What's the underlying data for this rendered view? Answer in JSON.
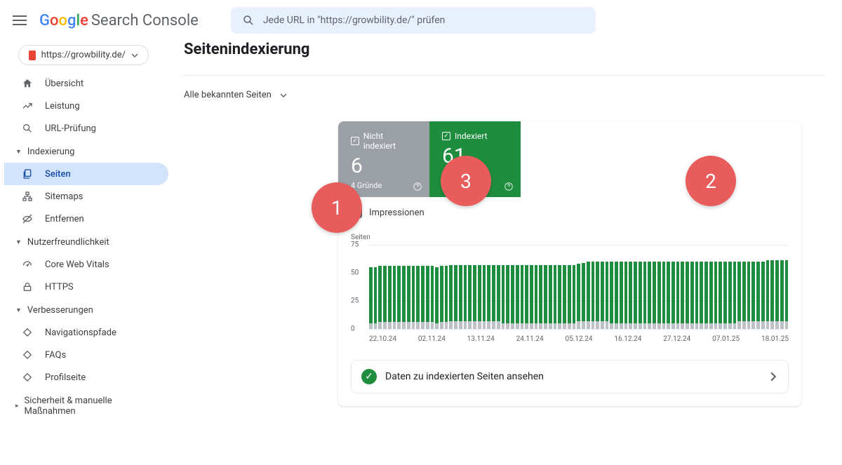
{
  "header": {
    "product_name": "Search Console",
    "search_placeholder": "Jede URL in \"https://growbility.de/\" prüfen"
  },
  "property": {
    "url": "https://growbility.de/"
  },
  "sidebar": {
    "items_top": [
      {
        "label": "Übersicht",
        "icon": "home"
      },
      {
        "label": "Leistung",
        "icon": "trend"
      },
      {
        "label": "URL-Prüfung",
        "icon": "search"
      }
    ],
    "section_index": "Indexierung",
    "items_index": [
      {
        "label": "Seiten",
        "icon": "pages",
        "active": true
      },
      {
        "label": "Sitemaps",
        "icon": "sitemaps"
      },
      {
        "label": "Entfernen",
        "icon": "remove"
      }
    ],
    "section_ux": "Nutzerfreundlichkeit",
    "items_ux": [
      {
        "label": "Core Web Vitals",
        "icon": "speed"
      },
      {
        "label": "HTTPS",
        "icon": "lock"
      }
    ],
    "section_enh": "Verbesserungen",
    "items_enh": [
      {
        "label": "Navigationspfade",
        "icon": "diamond"
      },
      {
        "label": "FAQs",
        "icon": "diamond"
      },
      {
        "label": "Profilseite",
        "icon": "diamond"
      }
    ],
    "section_sec": "Sicherheit & manuelle Maßnahmen"
  },
  "main": {
    "title": "Seitenindexierung",
    "filter": "Alle bekannten Seiten",
    "tile_not_indexed": {
      "label": "Nicht indexiert",
      "value": "6",
      "sub": "4 Gründe"
    },
    "tile_indexed": {
      "label": "Indexiert",
      "value": "61"
    },
    "impressions_label": "Impressionen",
    "cta_label": "Daten zu indexierten Seiten ansehen"
  },
  "annotations": {
    "a1": "1",
    "a2": "2",
    "a3": "3"
  },
  "chart_data": {
    "type": "bar",
    "title": "Seiten",
    "ylabel": "Seiten",
    "ylim": [
      0,
      75
    ],
    "yticks": [
      0,
      25,
      50,
      75
    ],
    "x_start": "22.10.24",
    "x_end": "18.01.25",
    "xticks": [
      "22.10.24",
      "02.11.24",
      "13.11.24",
      "24.11.24",
      "05.12.24",
      "16.12.24",
      "27.12.24",
      "07.01.25",
      "18.01.25"
    ],
    "series": [
      {
        "name": "Indexiert",
        "color": "#1e8e3e",
        "values": [
          55,
          55,
          56,
          56,
          56,
          56,
          56,
          56,
          56,
          56,
          56,
          56,
          56,
          56,
          55,
          56,
          56,
          57,
          57,
          57,
          57,
          57,
          57,
          57,
          57,
          57,
          57,
          57,
          57,
          57,
          57,
          57,
          57,
          57,
          57,
          57,
          57,
          57,
          57,
          57,
          57,
          57,
          57,
          57,
          58,
          59,
          60,
          60,
          60,
          60,
          60,
          60,
          60,
          60,
          60,
          60,
          60,
          60,
          60,
          60,
          60,
          60,
          60,
          60,
          60,
          60,
          60,
          60,
          60,
          60,
          60,
          60,
          60,
          60,
          60,
          60,
          60,
          60,
          60,
          60,
          60,
          60,
          60,
          60,
          61,
          61,
          61,
          61,
          61
        ]
      },
      {
        "name": "Nicht indexiert",
        "color": "#bdc1c6",
        "values": [
          5,
          5,
          6,
          6,
          6,
          6,
          6,
          6,
          6,
          6,
          6,
          6,
          6,
          6,
          5,
          6,
          6,
          7,
          7,
          7,
          7,
          7,
          7,
          7,
          7,
          7,
          7,
          7,
          5,
          5,
          5,
          5,
          5,
          5,
          5,
          5,
          5,
          5,
          5,
          5,
          5,
          5,
          5,
          5,
          7,
          7,
          7,
          7,
          7,
          7,
          7,
          5,
          5,
          5,
          5,
          5,
          5,
          5,
          5,
          5,
          5,
          5,
          5,
          5,
          5,
          5,
          5,
          5,
          5,
          5,
          5,
          5,
          5,
          5,
          5,
          5,
          5,
          5,
          7,
          7,
          7,
          7,
          7,
          7,
          7,
          7,
          7,
          7,
          7
        ]
      }
    ]
  }
}
